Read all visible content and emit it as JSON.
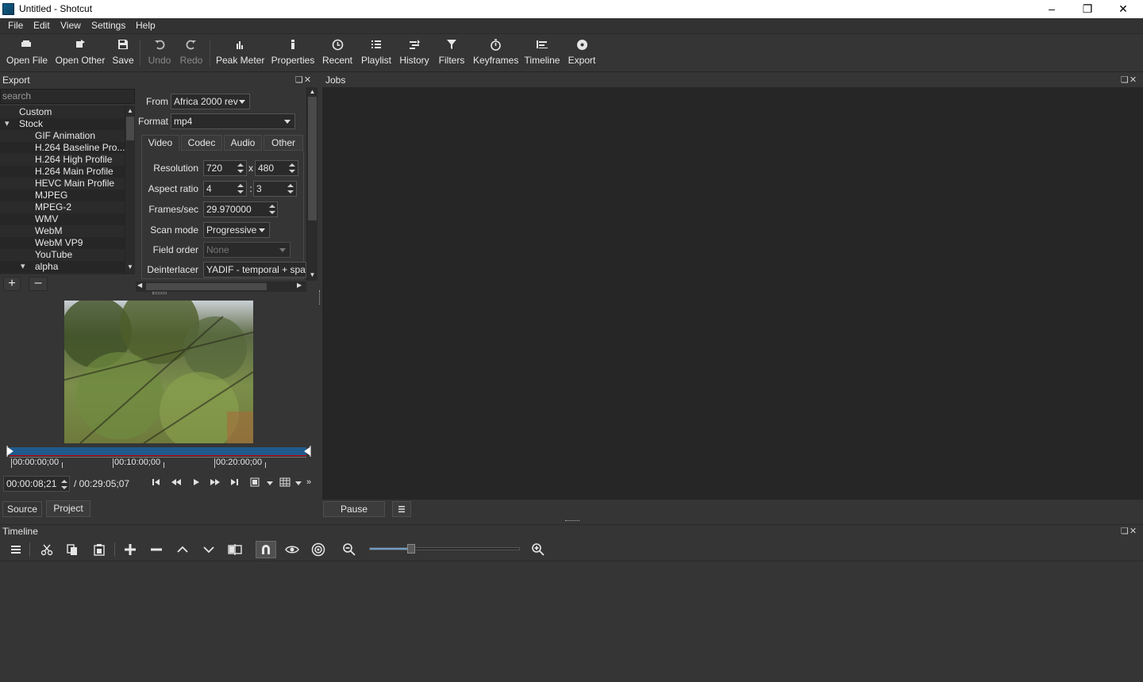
{
  "window": {
    "title": "Untitled - Shotcut",
    "controls": [
      "minimize",
      "restore",
      "close"
    ]
  },
  "menu": [
    "File",
    "Edit",
    "View",
    "Settings",
    "Help"
  ],
  "toolbar": {
    "open_file": "Open File",
    "open_other": "Open Other",
    "save": "Save",
    "undo": "Undo",
    "redo": "Redo",
    "peak_meter": "Peak Meter",
    "properties": "Properties",
    "recent": "Recent",
    "playlist": "Playlist",
    "history": "History",
    "filters": "Filters",
    "keyframes": "Keyframes",
    "timeline": "Timeline",
    "export": "Export"
  },
  "export_panel": {
    "title": "Export",
    "search_placeholder": "search",
    "presets": [
      {
        "label": "Custom",
        "indent": 1
      },
      {
        "label": "Stock",
        "indent": 0,
        "expanded": true
      },
      {
        "label": "GIF Animation",
        "indent": 2
      },
      {
        "label": "H.264 Baseline Pro...",
        "indent": 2
      },
      {
        "label": "H.264 High Profile",
        "indent": 2
      },
      {
        "label": "H.264 Main Profile",
        "indent": 2
      },
      {
        "label": "HEVC Main Profile",
        "indent": 2
      },
      {
        "label": "MJPEG",
        "indent": 2
      },
      {
        "label": "MPEG-2",
        "indent": 2
      },
      {
        "label": "WMV",
        "indent": 2
      },
      {
        "label": "WebM",
        "indent": 2
      },
      {
        "label": "WebM VP9",
        "indent": 2
      },
      {
        "label": "YouTube",
        "indent": 2
      },
      {
        "label": "alpha",
        "indent": 1,
        "expanded": true
      }
    ],
    "from_label": "From",
    "from_value": "Africa 2000 rev",
    "format_label": "Format",
    "format_value": "mp4",
    "tabs": [
      "Video",
      "Codec",
      "Audio",
      "Other"
    ],
    "active_tab": "Video",
    "resolution_label": "Resolution",
    "resolution_w": "720",
    "resolution_x": "x",
    "resolution_h": "480",
    "aspect_label": "Aspect ratio",
    "aspect_w": "4",
    "aspect_sep": ":",
    "aspect_h": "3",
    "fps_label": "Frames/sec",
    "fps_value": "29.970000",
    "scan_label": "Scan mode",
    "scan_value": "Progressive",
    "field_label": "Field order",
    "field_value": "None",
    "deint_label": "Deinterlacer",
    "deint_value": "YADIF - temporal + spatia"
  },
  "player": {
    "ruler_ticks": [
      "00:00:00;00",
      "00:10:00;00",
      "00:20:00;00"
    ],
    "position": "00:00:08;21",
    "duration": "/ 00:29:05;07",
    "tabs": [
      "Source",
      "Project"
    ]
  },
  "jobs": {
    "title": "Jobs",
    "pause_label": "Pause"
  },
  "timeline": {
    "title": "Timeline",
    "zoom_level": 0.28
  }
}
